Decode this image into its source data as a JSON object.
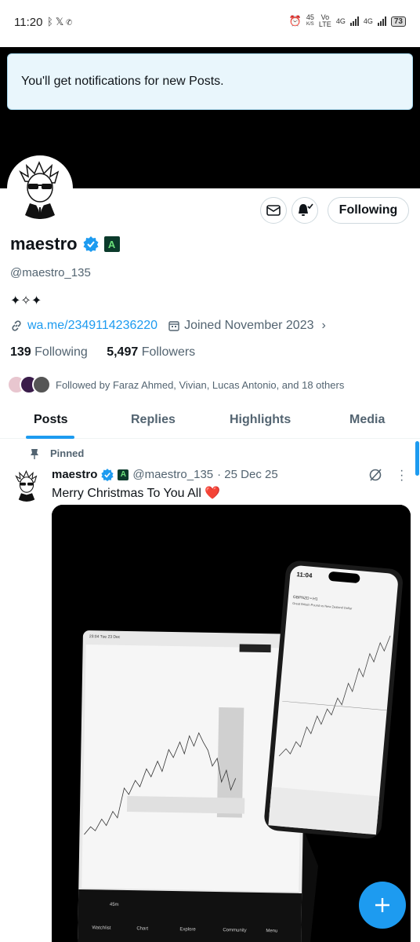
{
  "status": {
    "time": "11:20",
    "app_icons": [
      "signal-app-icon",
      "x-icon",
      "whatsapp-icon"
    ],
    "net_speed": "45",
    "net_unit": "K/S",
    "volte": "Vo LTE",
    "net_type_1": "4G",
    "net_type_2": "4G",
    "battery": "73"
  },
  "toast": {
    "text": "You'll get notifications for new Posts."
  },
  "actions": {
    "following_label": "Following"
  },
  "profile": {
    "name": "maestro",
    "affiliate_badge": "A",
    "handle": "@maestro_135",
    "bio": "✦✧✦",
    "link": "wa.me/2349114236220",
    "joined": "Joined November 2023",
    "following_count": "139",
    "following_label": "Following",
    "followers_count": "5,497",
    "followers_label": "Followers",
    "followed_by": "Followed by Faraz Ahmed, Vivian, Lucas Antonio, and 18 others"
  },
  "tabs": [
    {
      "label": "Posts"
    },
    {
      "label": "Replies"
    },
    {
      "label": "Highlights"
    },
    {
      "label": "Media"
    }
  ],
  "post": {
    "pinned_label": "Pinned",
    "name": "maestro",
    "badge": "A",
    "handle": "@maestro_135",
    "date": "· 25 Dec 25",
    "text": "Merry Christmas To You All ❤️",
    "image": {
      "phone_time": "11:04",
      "phone_symbol": "GBPNZD • H1",
      "phone_desc": "Great Britain Pound vs New Zealand Dollar",
      "tablet_time": "23:04 Tue 23 Dec",
      "tablet_timeframe": "45m",
      "tablet_nav": [
        "Watchlist",
        "Chart",
        "Explore",
        "Community",
        "Menu"
      ]
    }
  },
  "colors": {
    "accent": "#1d9bf0",
    "text": "#0f1419",
    "muted": "#536471"
  }
}
